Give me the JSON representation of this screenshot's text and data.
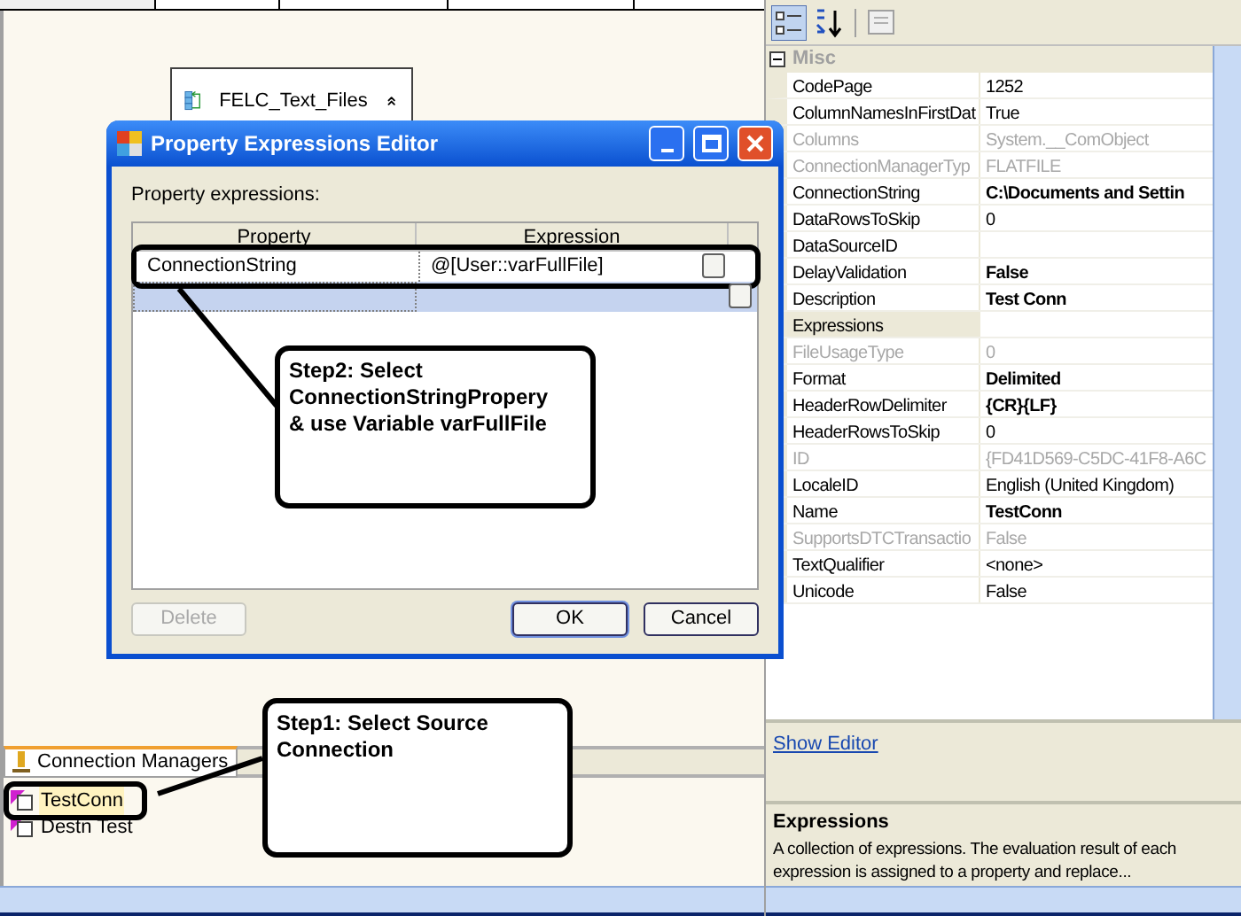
{
  "designer": {
    "task": {
      "name": "FELC_Text_Files",
      "expanded": true
    },
    "connection_managers": {
      "tab": "Connection Managers",
      "items": [
        {
          "name": "TestConn",
          "selected": true
        },
        {
          "name": "Destn Test",
          "selected": false
        }
      ]
    }
  },
  "dialog": {
    "title": "Property Expressions Editor",
    "label": "Property expressions:",
    "columns": [
      "Property",
      "Expression"
    ],
    "rows": [
      {
        "property": "ConnectionString",
        "expression": "@[User::varFullFile]",
        "selected": false
      },
      {
        "selected": true
      }
    ],
    "buttons": [
      {
        "label": "Delete",
        "disabled": true,
        "default": false
      },
      {
        "label": "OK",
        "disabled": false,
        "default": true
      },
      {
        "label": "Cancel",
        "disabled": false,
        "default": false
      }
    ]
  },
  "callouts": [
    {
      "lines": [
        "Step2: Select",
        "ConnectionStringPropery",
        "& use Variable varFullFile"
      ]
    },
    {
      "lines": [
        "Step1: Select Source",
        "Connection"
      ]
    }
  ],
  "properties": {
    "category": "Misc",
    "expanded": true,
    "items": [
      {
        "name": "CodePage",
        "value": "1252",
        "disabled": false,
        "bold": false,
        "selected": false
      },
      {
        "name": "ColumnNamesInFirstDat",
        "value": "True",
        "disabled": false,
        "bold": false,
        "selected": false
      },
      {
        "name": "Columns",
        "value": "System.__ComObject",
        "disabled": true,
        "bold": false,
        "selected": false
      },
      {
        "name": "ConnectionManagerTyp",
        "value": "FLATFILE",
        "disabled": true,
        "bold": false,
        "selected": false
      },
      {
        "name": "ConnectionString",
        "value": "C:\\Documents and Settin",
        "disabled": false,
        "bold": true,
        "selected": false
      },
      {
        "name": "DataRowsToSkip",
        "value": "0",
        "disabled": false,
        "bold": false,
        "selected": false
      },
      {
        "name": "DataSourceID",
        "disabled": false,
        "selected": false
      },
      {
        "name": "DelayValidation",
        "value": "False",
        "disabled": false,
        "bold": true,
        "selected": false
      },
      {
        "name": "Description",
        "value": "Test Conn",
        "disabled": false,
        "bold": true,
        "selected": false
      },
      {
        "name": "Expressions",
        "disabled": false,
        "selected": true
      },
      {
        "name": "FileUsageType",
        "value": "0",
        "disabled": true,
        "bold": false,
        "selected": false
      },
      {
        "name": "Format",
        "value": "Delimited",
        "disabled": false,
        "bold": true,
        "selected": false
      },
      {
        "name": "HeaderRowDelimiter",
        "value": "{CR}{LF}",
        "disabled": false,
        "bold": true,
        "selected": false
      },
      {
        "name": "HeaderRowsToSkip",
        "value": "0",
        "disabled": false,
        "bold": false,
        "selected": false
      },
      {
        "name": "ID",
        "value": "{FD41D569-C5DC-41F8-A6C",
        "disabled": true,
        "bold": false,
        "selected": false
      },
      {
        "name": "LocaleID",
        "value": "English (United Kingdom)",
        "disabled": false,
        "bold": false,
        "selected": false
      },
      {
        "name": "Name",
        "value": "TestConn",
        "disabled": false,
        "bold": true,
        "selected": false
      },
      {
        "name": "SupportsDTCTransactio",
        "value": "False",
        "disabled": true,
        "bold": false,
        "selected": false
      },
      {
        "name": "TextQualifier",
        "value": "<none>",
        "disabled": false,
        "bold": false,
        "selected": false
      },
      {
        "name": "Unicode",
        "value": "False",
        "disabled": false,
        "bold": false,
        "selected": false
      }
    ]
  },
  "show_editor": "Show Editor",
  "description": {
    "title": "Expressions",
    "text": "A collection of expressions. The evaluation result of each expression is assigned to a property and replace..."
  }
}
